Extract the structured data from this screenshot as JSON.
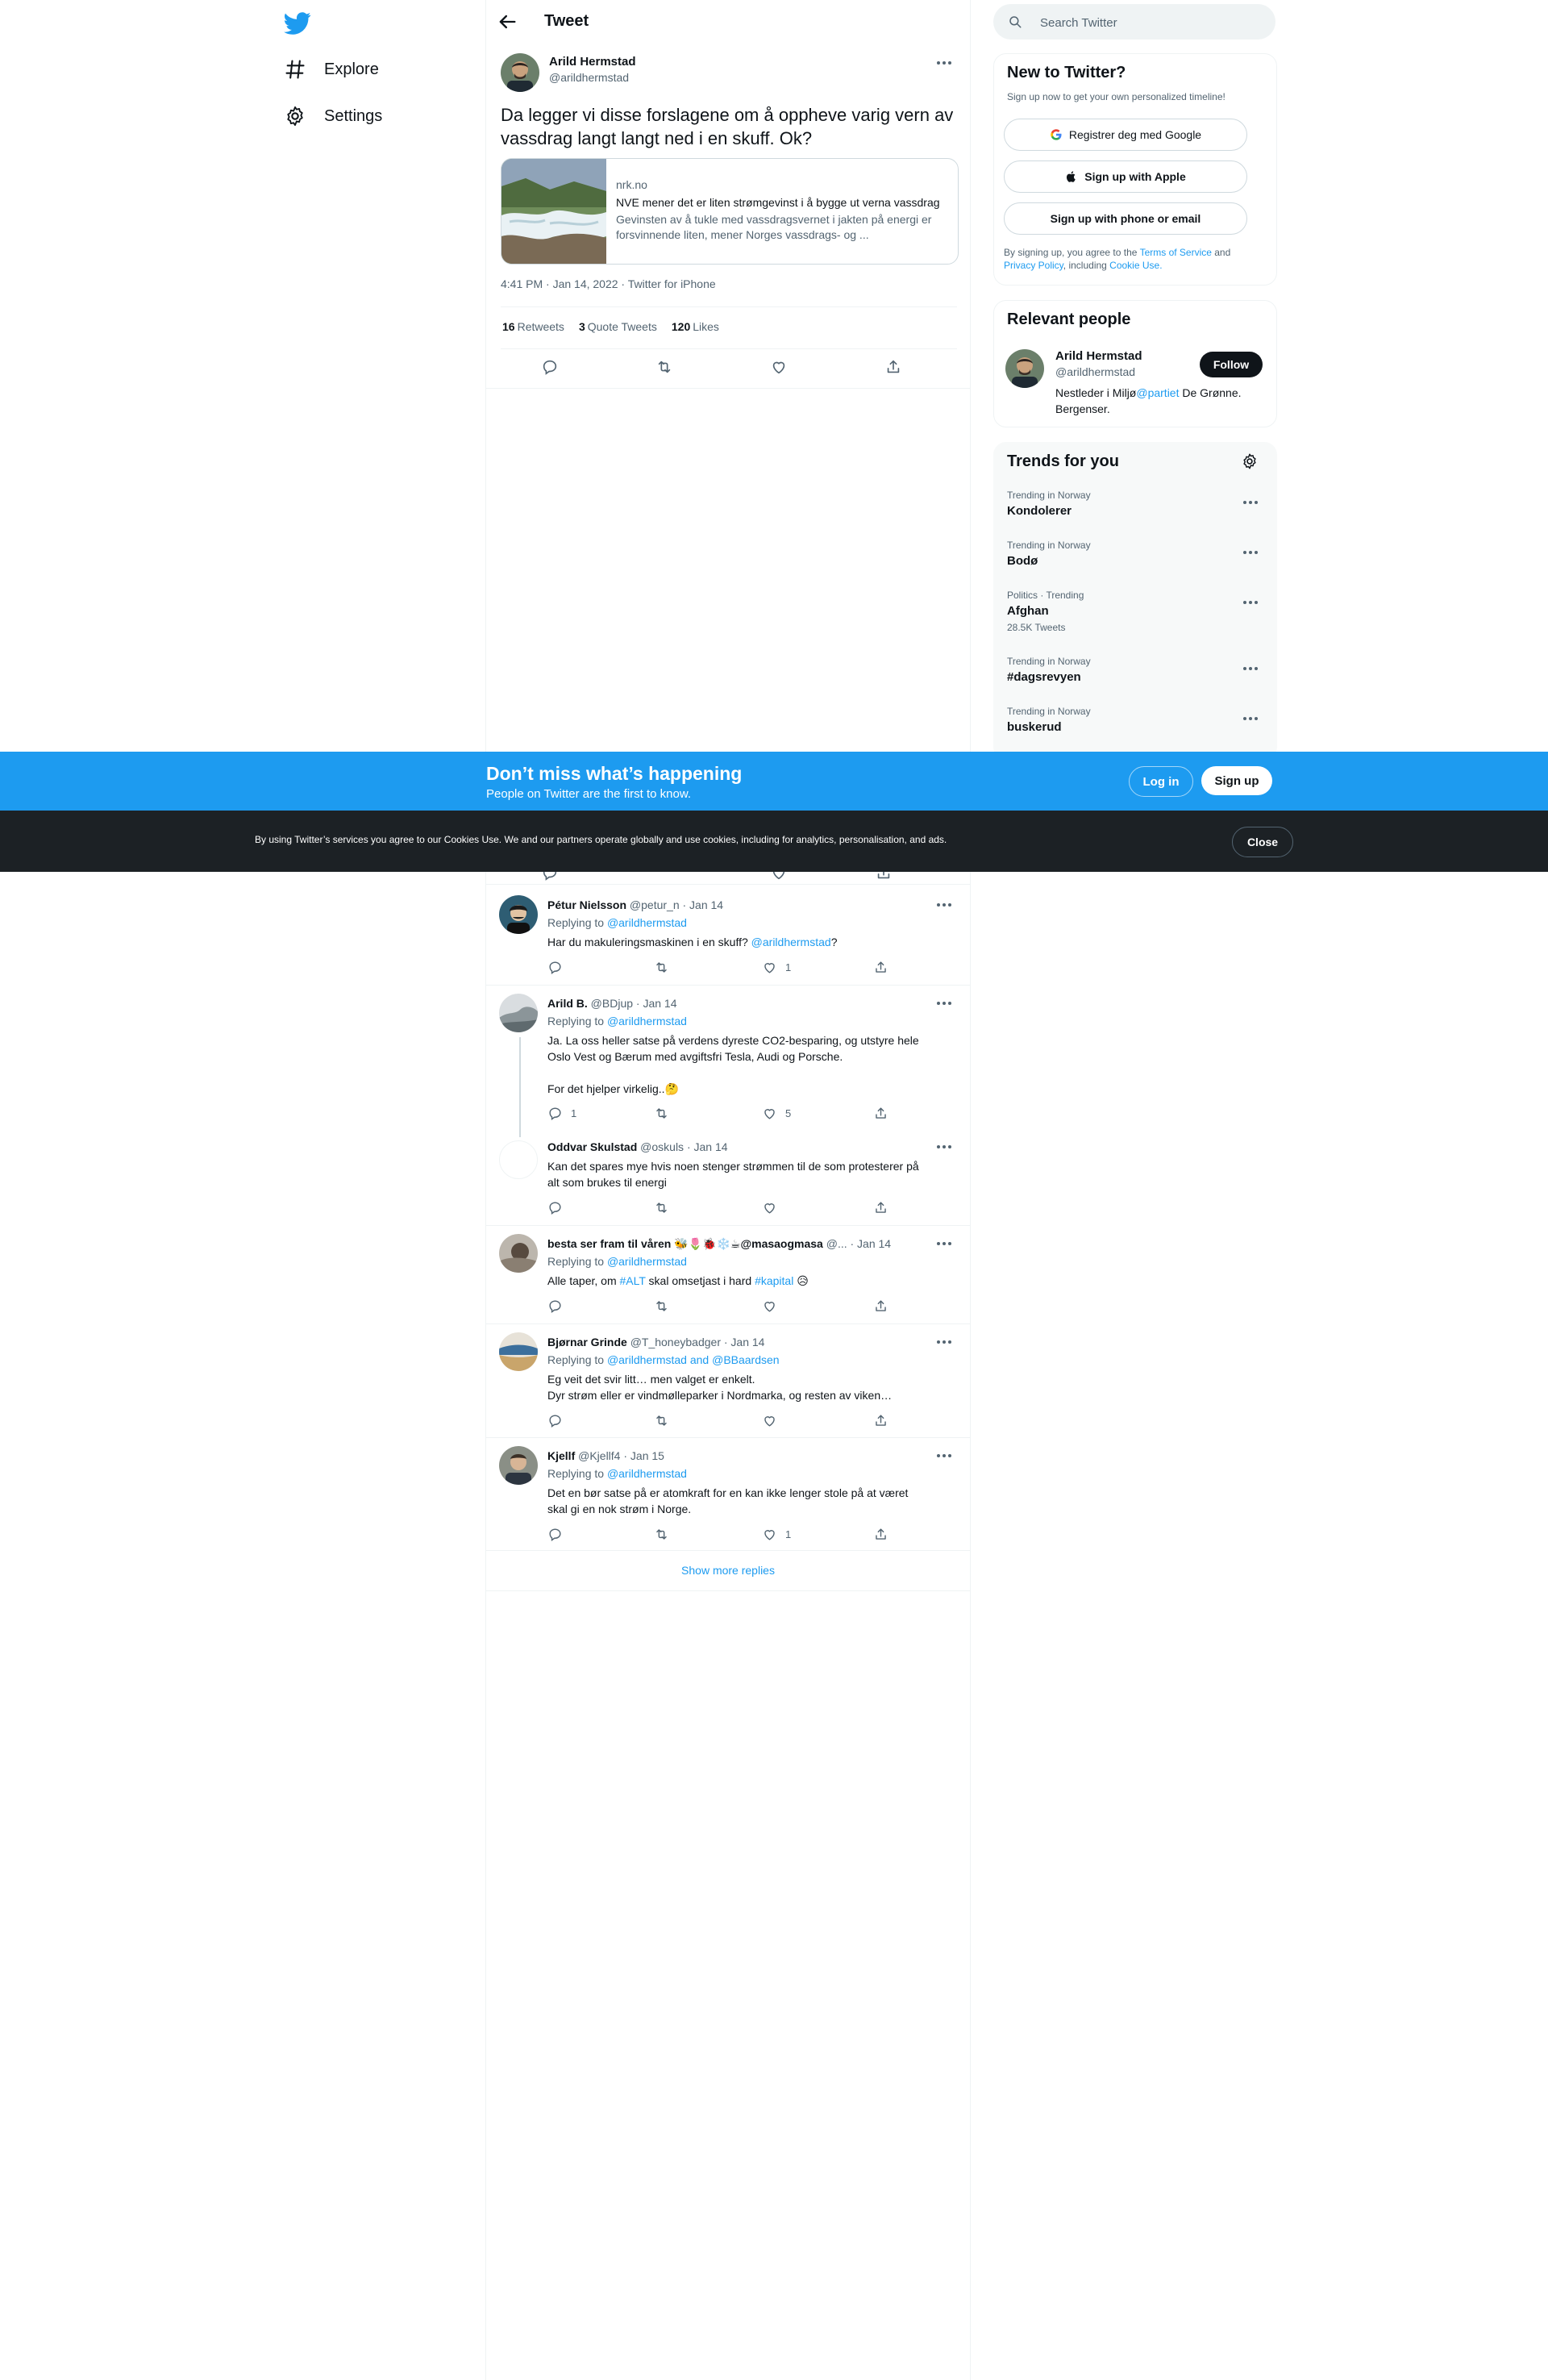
{
  "nav": {
    "explore": "Explore",
    "settings": "Settings"
  },
  "header": {
    "title": "Tweet"
  },
  "tweet": {
    "name": "Arild Hermstad",
    "handle": "@arildhermstad",
    "text": "Da legger vi disse forslagene om å oppheve varig vern av vassdrag langt langt ned i en skuff. Ok?",
    "card": {
      "domain": "nrk.no",
      "title": "NVE mener det er liten strømgevinst i å bygge ut verna vassdrag",
      "description": "Gevinsten av å tukle med vassdragsvernet i jakten på energi er forsvinnende liten, mener Norges vassdrags- og ..."
    },
    "meta": "4:41 PM · Jan 14, 2022 · Twitter for iPhone",
    "stats": {
      "retweets": "16",
      "retweets_label": "Retweets",
      "quotes": "3",
      "quotes_label": "Quote Tweets",
      "likes": "120",
      "likes_label": "Likes"
    }
  },
  "replies": [
    {
      "name": "Pétur Nielsson",
      "meta": "@petur_n · Jan 14",
      "replying_label": "Replying to",
      "replying_to": "@arildhermstad",
      "text_pre": "Har du makuleringsmaskinen i en skuff? ",
      "text_link": "@arildhermstad",
      "text_post": "?",
      "likes": "1"
    },
    {
      "name": "Arild B.",
      "meta": "@BDjup · Jan 14",
      "replying_label": "Replying to",
      "replying_to": "@arildhermstad",
      "text_line1": "Ja. La oss heller satse på verdens dyreste CO2-besparing, og utstyre hele",
      "text_line2": "Oslo Vest og Bærum med avgiftsfri Tesla, Audi og Porsche.",
      "text_line3": "For det hjelper virkelig..🤔",
      "replies": "1",
      "likes": "5"
    },
    {
      "name": "Oddvar Skulstad",
      "meta": "@oskuls · Jan 14",
      "text_line1": "Kan det spares mye hvis noen stenger strømmen til de som protesterer på",
      "text_line2": "alt som brukes til energi"
    },
    {
      "name": "besta ser fram til våren 🐝🌷🐞❄️☕@masaogmasa",
      "meta": "@... · Jan 14",
      "replying_label": "Replying to",
      "replying_to": "@arildhermstad",
      "text_pre": "Alle taper, om ",
      "text_tag1": "#ALT",
      "text_mid": " skal omsetjast i hard ",
      "text_tag2": "#kapital",
      "text_post": " 😥"
    },
    {
      "name": "Bjørnar Grinde",
      "meta": "@T_honeybadger · Jan 14",
      "replying_label": "Replying to",
      "replying_to": "@arildhermstad and @BBaardsen",
      "text_line1": "Eg veit det svir litt… men valget er enkelt.",
      "text_line2": "Dyr strøm eller er vindmølleparker i Nordmarka, og resten av viken…"
    },
    {
      "name": "Kjellf",
      "meta": "@Kjellf4 · Jan 15",
      "replying_label": "Replying to",
      "replying_to": "@arildhermstad",
      "text_line1": "Det en bør satse på er atomkraft for en kan ikke lenger stole på at været",
      "text_line2": "skal gi en nok strøm i Norge.",
      "likes": "1"
    }
  ],
  "show_more": "Show more replies",
  "search": {
    "placeholder": "Search Twitter"
  },
  "signup_box": {
    "title": "New to Twitter?",
    "subtitle": "Sign up now to get your own personalized timeline!",
    "google": "Registrer deg med Google",
    "apple": "Sign up with Apple",
    "phone": "Sign up with phone or email",
    "legal_1": "By signing up, you agree to the ",
    "terms": "Terms of Service",
    "legal_2": " and",
    "privacy": "Privacy Policy",
    "legal_3": ", including ",
    "cookie": "Cookie Use."
  },
  "relevant": {
    "title": "Relevant people",
    "name": "Arild Hermstad",
    "handle": "@arildhermstad",
    "follow": "Follow",
    "bio_pre": "Nestleder i Miljø",
    "bio_link": "@partiet",
    "bio_post": " De Grønne.",
    "bio_line2": "Bergenser."
  },
  "trends": {
    "title": "Trends for you",
    "items": [
      {
        "context": "Trending in Norway",
        "name": "Kondolerer"
      },
      {
        "context": "Trending in Norway",
        "name": "Bodø"
      },
      {
        "context": "Politics · Trending",
        "name": "Afghan",
        "count": "28.5K Tweets"
      },
      {
        "context": "Trending in Norway",
        "name": "#dagsrevyen"
      },
      {
        "context": "Trending in Norway",
        "name": "buskerud"
      }
    ]
  },
  "banner": {
    "title": "Don’t miss what’s happening",
    "subtitle": "People on Twitter are the first to know.",
    "login": "Log in",
    "signup": "Sign up"
  },
  "cookie_bar": {
    "text": "By using Twitter’s services you agree to our Cookies Use. We and our partners operate globally and use cookies, including for analytics, personalisation, and ads.",
    "close": "Close"
  },
  "colors": {
    "accent": "#1d9bf0",
    "text": "#0f1419",
    "muted": "#536471",
    "cookie_bg": "#1c2125"
  }
}
